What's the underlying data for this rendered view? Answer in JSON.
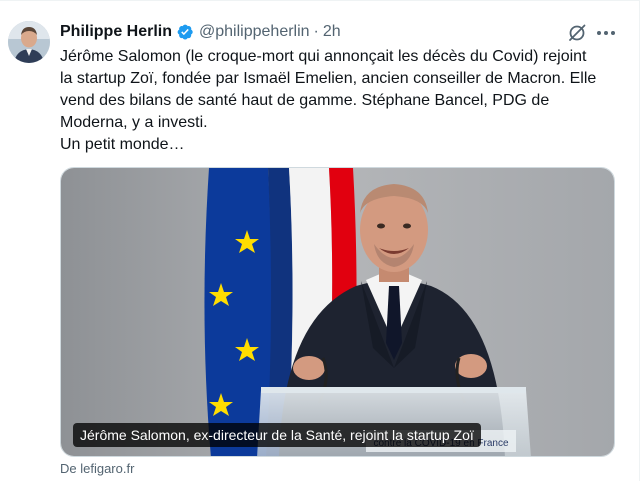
{
  "tweet": {
    "author_name": "Philippe Herlin",
    "handle": "@philippeherlin",
    "separator": "·",
    "time": "2h",
    "verified_icon": "verified-badge-icon",
    "text_lines": [
      "Jérôme Salomon (le croque-mort qui annonçait les décès du Covid) rejoint",
      "la startup Zoï, fondée par Ismaël Emelien, ancien conseiller de Macron. Elle",
      "vend des bilans de santé haut de gamme. Stéphane Bancel, PDG de",
      "Moderna, y a investi.",
      "Un petit monde…"
    ],
    "actions": {
      "grok_icon": "grok-icon",
      "more_icon": "more-options-icon"
    }
  },
  "card": {
    "caption": "Jérôme Salomon, ex-directeur de la Santé, rejoint la startup Zoï",
    "lectern_text": "contre la COVID-19 en France",
    "source": "De lefigaro.fr"
  },
  "colors": {
    "accent": "#1d9bf0",
    "text_primary": "#0f1419",
    "text_secondary": "#536471",
    "eu_blue": "#0c3a9b",
    "eu_star": "#ffdd00",
    "french_red": "#e1000f"
  }
}
